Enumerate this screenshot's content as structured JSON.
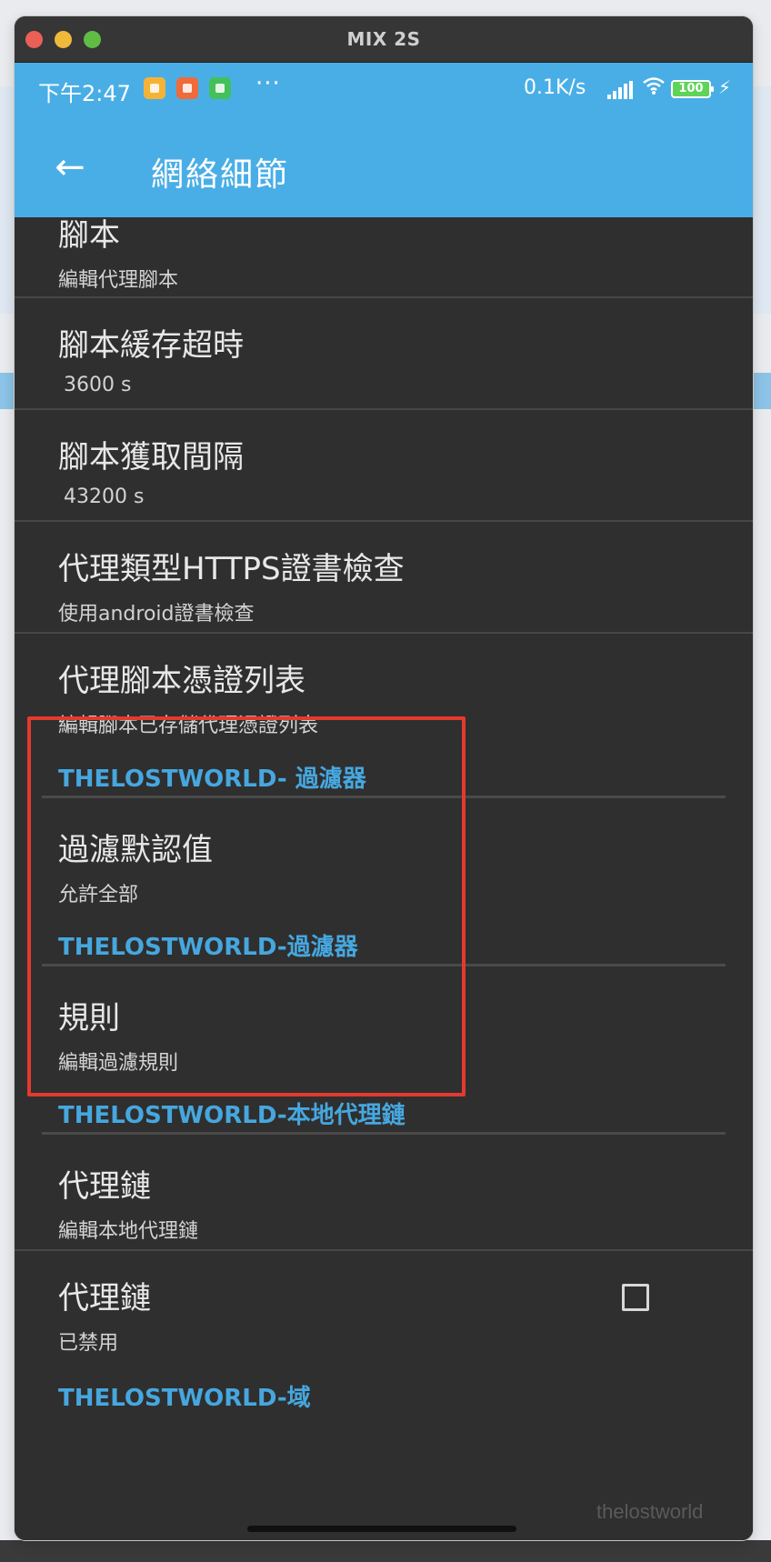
{
  "window": {
    "title": "MIX 2S"
  },
  "status_bar": {
    "time": "下午2:47",
    "more": "···",
    "net_speed": "0.1K/s",
    "battery": "100",
    "icons": [
      "app-icon-yellow",
      "app-icon-orange",
      "app-icon-green",
      "signal-icon",
      "wifi-icon",
      "battery-icon",
      "charging-bolt-icon"
    ]
  },
  "app_bar": {
    "title": "網絡細節",
    "back_icon": "←"
  },
  "items": [
    {
      "title": "腳本",
      "subtitle": "編輯代理腳本"
    },
    {
      "title": "腳本緩存超時",
      "subtitle": "3600 s"
    },
    {
      "title": "腳本獲取間隔",
      "subtitle": "43200 s"
    },
    {
      "title": "代理類型HTTPS證書檢查",
      "subtitle": "使用android證書檢查"
    },
    {
      "title": "代理腳本憑證列表",
      "subtitle": "編輯腳本已存儲代理憑證列表"
    }
  ],
  "sections": [
    {
      "header": "THELOSTWORLD- 過濾器",
      "items": [
        {
          "title": "過濾默認值",
          "subtitle": "允許全部"
        }
      ]
    },
    {
      "header": "THELOSTWORLD-過濾器",
      "items": [
        {
          "title": "規則",
          "subtitle": "編輯過濾規則"
        }
      ]
    },
    {
      "header": "THELOSTWORLD-本地代理鏈",
      "items": [
        {
          "title": "代理鏈",
          "subtitle": "編輯本地代理鏈"
        },
        {
          "title": "代理鏈",
          "subtitle": "已禁用",
          "checked": false
        }
      ]
    },
    {
      "header": "THELOSTWORLD-域"
    }
  ],
  "watermark": "thelostworld",
  "colors": {
    "accent": "#4aaee6",
    "header_text": "#46a7df",
    "background": "#2f2f2f",
    "highlight_box": "#e33a2f"
  }
}
